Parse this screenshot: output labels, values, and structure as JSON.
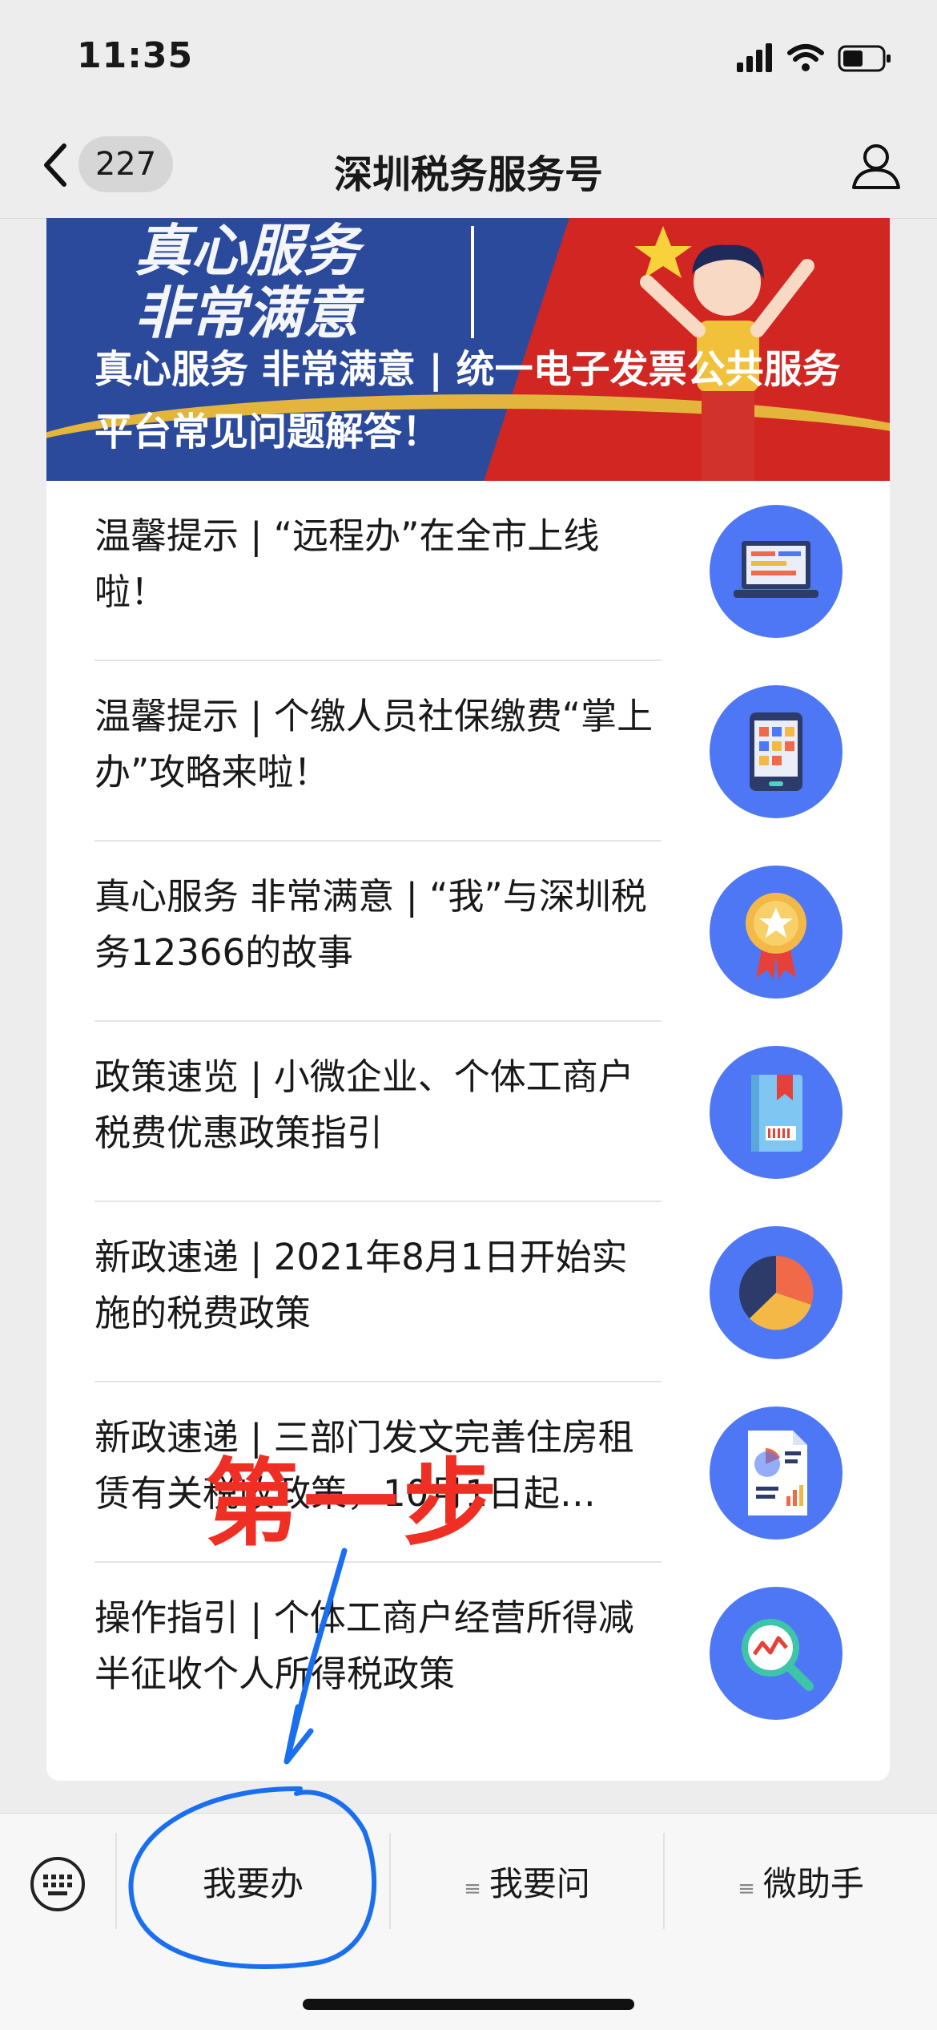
{
  "status": {
    "time": "11:35"
  },
  "nav": {
    "badge": "227",
    "title": "深圳税务服务号"
  },
  "banner": {
    "big_line1": "真心服务",
    "big_line2": "非常满意",
    "caption": "真心服务 非常满意 | 统一电子发票公共服务平台常见问题解答！"
  },
  "articles": [
    {
      "title": "温馨提示 | “远程办”在全市上线啦！",
      "icon": "laptop-icon"
    },
    {
      "title": "温馨提示 | 个缴人员社保缴费“掌上办”攻略来啦！",
      "icon": "tablet-icon"
    },
    {
      "title": "真心服务 非常满意 | “我”与深圳税务12366的故事",
      "icon": "medal-icon"
    },
    {
      "title": "政策速览 | 小微企业、个体工商户税费优惠政策指引",
      "icon": "book-icon"
    },
    {
      "title": "新政速递 | 2021年8月1日开始实施的税费政策",
      "icon": "pie-chart-icon"
    },
    {
      "title": "新政速递 | 三部门发文完善住房租赁有关税收政策，10月1日起…",
      "icon": "report-icon"
    },
    {
      "title": "操作指引 | 个体工商户经营所得减半征收个人所得税政策",
      "icon": "magnifier-chart-icon"
    }
  ],
  "annotation": {
    "text": "第一步"
  },
  "menu": {
    "item1": "我要办",
    "item2": "我要问",
    "item3": "微助手"
  },
  "colors": {
    "accent_blue": "#4e77f5",
    "annotation_red": "#ef2e24",
    "annotation_blue": "#1a6ff0"
  }
}
